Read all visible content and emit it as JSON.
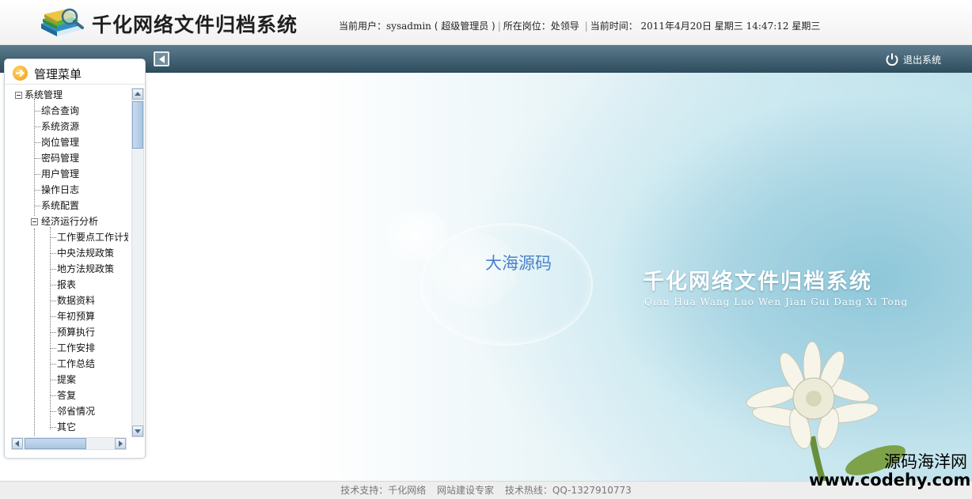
{
  "header": {
    "title": "千化网络文件归档系统",
    "current_user_label": "当前用户：",
    "user": "sysadmin",
    "role": "( 超级管理员 )",
    "post_label": "所在岗位：",
    "post": "处领导",
    "time_label": "当前时间：",
    "date": "2011年4月20日 星期三",
    "time": "14:47:12 星期三"
  },
  "navbar": {
    "logout_label": "退出系统"
  },
  "sidebar": {
    "title": "管理菜单",
    "root": "系统管理",
    "items": [
      "综合查询",
      "系统资源",
      "岗位管理",
      "密码管理",
      "用户管理",
      "操作日志",
      "系统配置"
    ],
    "group": "经济运行分析",
    "group_items": [
      "工作要点工作计划",
      "中央法规政策",
      "地方法规政策",
      "报表",
      "数据资料",
      "年初预算",
      "预算执行",
      "工作安排",
      "工作总结",
      "提案",
      "答复",
      "邻省情况",
      "其它"
    ]
  },
  "main": {
    "watermark": "大海源码",
    "title": "千化网络文件归档系统",
    "pinyin": "Qian Hua Wang Luo Wen Jian Gui Dang Xi Tong"
  },
  "footer": {
    "support": "技术支持：千化网络",
    "slogan": "网站建设专家",
    "hotline": "技术热线：QQ-1327910773"
  },
  "brand_watermark": {
    "name": "源码海洋网",
    "url": "www.codehy.com"
  },
  "colors": {
    "navbar": "#3d5d6e",
    "accent_orange": "#f29a0f",
    "watermark_blue": "#4a82c8"
  }
}
